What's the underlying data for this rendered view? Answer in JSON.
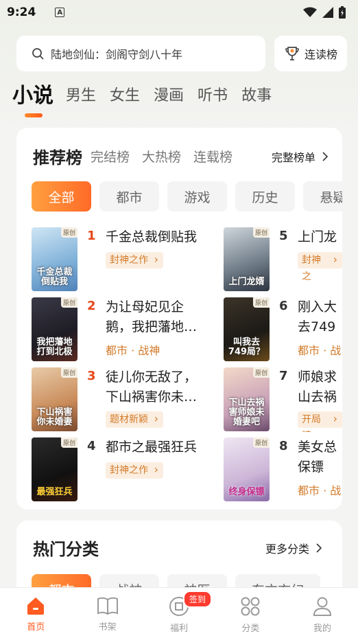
{
  "status_bar": {
    "time": "9:24",
    "notif_icon": "A"
  },
  "search": {
    "placeholder": "陆地剑仙：剑阁守剑八十年"
  },
  "rank_button": {
    "label": "连读榜"
  },
  "top_tabs": [
    {
      "label": "小说",
      "active": true
    },
    {
      "label": "男生"
    },
    {
      "label": "女生"
    },
    {
      "label": "漫画"
    },
    {
      "label": "听书"
    },
    {
      "label": "故事"
    }
  ],
  "rank_section": {
    "tabs": [
      {
        "label": "推荐榜",
        "active": true
      },
      {
        "label": "完结榜"
      },
      {
        "label": "大热榜"
      },
      {
        "label": "连载榜"
      }
    ],
    "full_link": "完整榜单",
    "chips": [
      "全部",
      "都市",
      "游戏",
      "历史",
      "悬疑"
    ],
    "books": [
      {
        "rank": "1",
        "title": "千金总裁倒贴我",
        "tag": "封神之作",
        "cover_tag": "原创",
        "cover_text": "千金总裁倒贴我"
      },
      {
        "rank": "2",
        "title": "为让母妃见企鹅，我把藩地…",
        "genre": "都市 · 战神",
        "cover_tag": "原创",
        "cover_text": "我把藩地打到北极"
      },
      {
        "rank": "3",
        "title": "徒儿你无敌了，下山祸害你未…",
        "tag": "题材新颖",
        "cover_tag": "原创",
        "cover_text": "下山祸害你未婚妻"
      },
      {
        "rank": "4",
        "title": "都市之最强狂兵",
        "tag": "封神之作",
        "cover_tag": "原创",
        "cover_text": "最强狂兵"
      },
      {
        "rank": "5",
        "title": "上门龙",
        "tag": "封神之",
        "cover_tag": "原创",
        "cover_text": "上门龙婿"
      },
      {
        "rank": "6",
        "title": "刚入大去749",
        "genre": "都市 · 战",
        "cover_tag": "原创",
        "cover_text": "叫我去749局？"
      },
      {
        "rank": "7",
        "title": "师娘求山去祸",
        "tag": "开局精",
        "cover_tag": "原创",
        "cover_text": "下山去祸害师娘未婚妻吧"
      },
      {
        "rank": "8",
        "title": "美女总保镖",
        "genre": "都市 · 战",
        "cover_tag": "原创",
        "cover_text": "终身保镖"
      }
    ]
  },
  "category_section": {
    "title": "热门分类",
    "more": "更多分类",
    "chips": [
      "都市",
      "战神",
      "神医",
      "东方玄幻"
    ]
  },
  "bottom_nav": [
    {
      "label": "首页",
      "icon": "home-icon",
      "active": true
    },
    {
      "label": "书架",
      "icon": "book-icon"
    },
    {
      "label": "福利",
      "icon": "gift-icon",
      "badge": "签到"
    },
    {
      "label": "分类",
      "icon": "category-icon"
    },
    {
      "label": "我的",
      "icon": "user-icon"
    }
  ],
  "colors": {
    "accent": "#ff5a1f",
    "hot_rank": "#e8471a",
    "tag_text": "#d37b2a",
    "tag_bg": "#fbeee0"
  }
}
